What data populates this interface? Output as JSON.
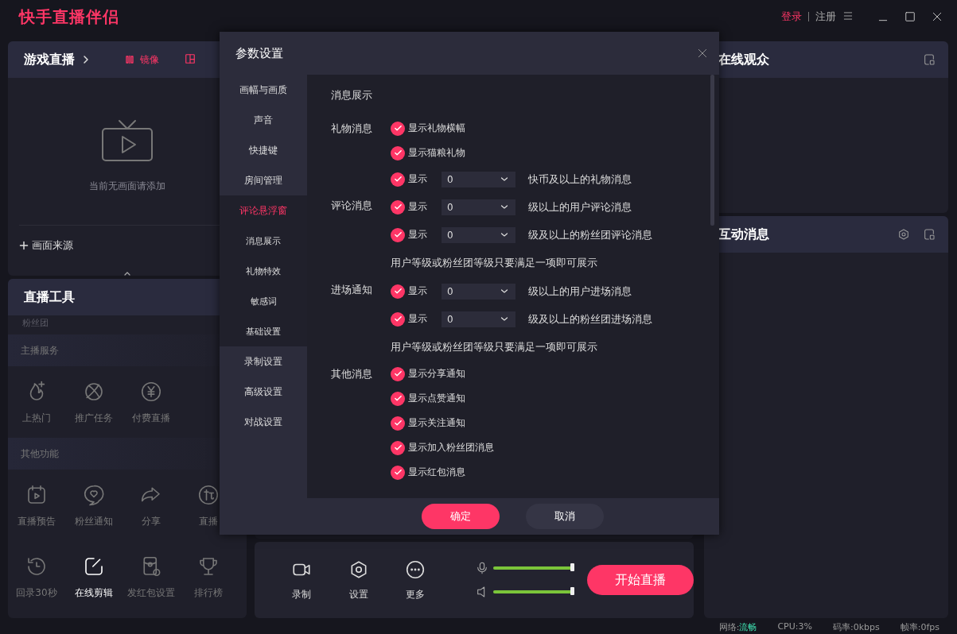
{
  "app": {
    "title": "快手直播伴侣",
    "login": "登录",
    "register": "注册"
  },
  "live_panel": {
    "title": "游戏直播",
    "mirror": "镜像",
    "empty_text": "当前无画面请添加",
    "add_source": "画面来源"
  },
  "tools_panel": {
    "title": "直播工具",
    "partial_item": "粉丝团",
    "sections": [
      {
        "title": "主播服务",
        "tools": [
          {
            "kind": "hot",
            "label": "上热门",
            "selected": false
          },
          {
            "kind": "promo",
            "label": "推广任务",
            "selected": false
          },
          {
            "kind": "paid",
            "label": "付费直播",
            "selected": false
          }
        ]
      },
      {
        "title": "其他功能",
        "tools": [
          {
            "kind": "preview",
            "label": "直播预告",
            "selected": false
          },
          {
            "kind": "notify",
            "label": "粉丝通知",
            "selected": false
          },
          {
            "kind": "share",
            "label": "分享",
            "selected": false
          },
          {
            "kind": "host",
            "label": "直播",
            "selected": false
          },
          {
            "kind": "replay",
            "label": "回录30秒",
            "selected": false
          },
          {
            "kind": "edit",
            "label": "在线剪辑",
            "selected": true
          },
          {
            "kind": "packet",
            "label": "发红包设置",
            "selected": false
          },
          {
            "kind": "rank",
            "label": "排行榜",
            "selected": false
          }
        ]
      }
    ]
  },
  "toolbar": {
    "buttons": [
      {
        "kind": "record",
        "label": "录制"
      },
      {
        "kind": "settings",
        "label": "设置"
      },
      {
        "kind": "more",
        "label": "更多"
      }
    ],
    "mic": {
      "level": 1
    },
    "speaker": {
      "level": 1
    },
    "start": "开始直播"
  },
  "audience": {
    "title": "在线观众"
  },
  "interaction": {
    "title": "互动消息"
  },
  "status_bar": {
    "network_label": "网络:",
    "network_value": "流畅",
    "cpu": "CPU:3%",
    "bitrate": "码率:0kbps",
    "fps": "帧率:0fps"
  },
  "dialog": {
    "title": "参数设置",
    "nav": [
      {
        "label": "画幅与画质",
        "selected": false
      },
      {
        "label": "声音",
        "selected": false
      },
      {
        "label": "快捷键",
        "selected": false
      },
      {
        "label": "房间管理",
        "selected": false
      },
      {
        "label": "评论悬浮窗",
        "selected": true,
        "children": [
          {
            "label": "消息展示",
            "selected": false
          },
          {
            "label": "礼物特效",
            "selected": false
          },
          {
            "label": "敏感词",
            "selected": false
          },
          {
            "label": "基础设置",
            "selected": false
          }
        ]
      },
      {
        "label": "录制设置",
        "selected": false
      },
      {
        "label": "高级设置",
        "selected": false
      },
      {
        "label": "对战设置",
        "selected": false
      }
    ],
    "heading": "消息展示",
    "sections": [
      {
        "label": "礼物消息",
        "options": [
          {
            "kind": "check",
            "label": "显示礼物横幅",
            "checked": true
          },
          {
            "kind": "check",
            "label": "显示猫粮礼物",
            "checked": true
          },
          {
            "kind": "threshold",
            "label": "显示",
            "checked": true,
            "value": "0",
            "suffix": "快币及以上的礼物消息"
          }
        ]
      },
      {
        "label": "评论消息",
        "options": [
          {
            "kind": "threshold",
            "label": "显示",
            "checked": true,
            "value": "0",
            "suffix": "级以上的用户评论消息"
          },
          {
            "kind": "threshold",
            "label": "显示",
            "checked": true,
            "value": "0",
            "suffix": "级及以上的粉丝团评论消息"
          }
        ],
        "note": "用户等级或粉丝团等级只要满足一项即可展示"
      },
      {
        "label": "进场通知",
        "options": [
          {
            "kind": "threshold",
            "label": "显示",
            "checked": true,
            "value": "0",
            "suffix": "级以上的用户进场消息"
          },
          {
            "kind": "threshold",
            "label": "显示",
            "checked": true,
            "value": "0",
            "suffix": "级及以上的粉丝团进场消息"
          }
        ],
        "note": "用户等级或粉丝团等级只要满足一项即可展示"
      },
      {
        "label": "其他消息",
        "options": [
          {
            "kind": "check",
            "label": "显示分享通知",
            "checked": true
          },
          {
            "kind": "check",
            "label": "显示点赞通知",
            "checked": true
          },
          {
            "kind": "check",
            "label": "显示关注通知",
            "checked": true
          },
          {
            "kind": "check",
            "label": "显示加入粉丝团消息",
            "checked": true
          },
          {
            "kind": "check",
            "label": "显示红包消息",
            "checked": true
          }
        ]
      }
    ],
    "buttons": [
      {
        "kind": "primary",
        "label": "确定"
      },
      {
        "kind": "secondary",
        "label": "取消"
      }
    ]
  }
}
